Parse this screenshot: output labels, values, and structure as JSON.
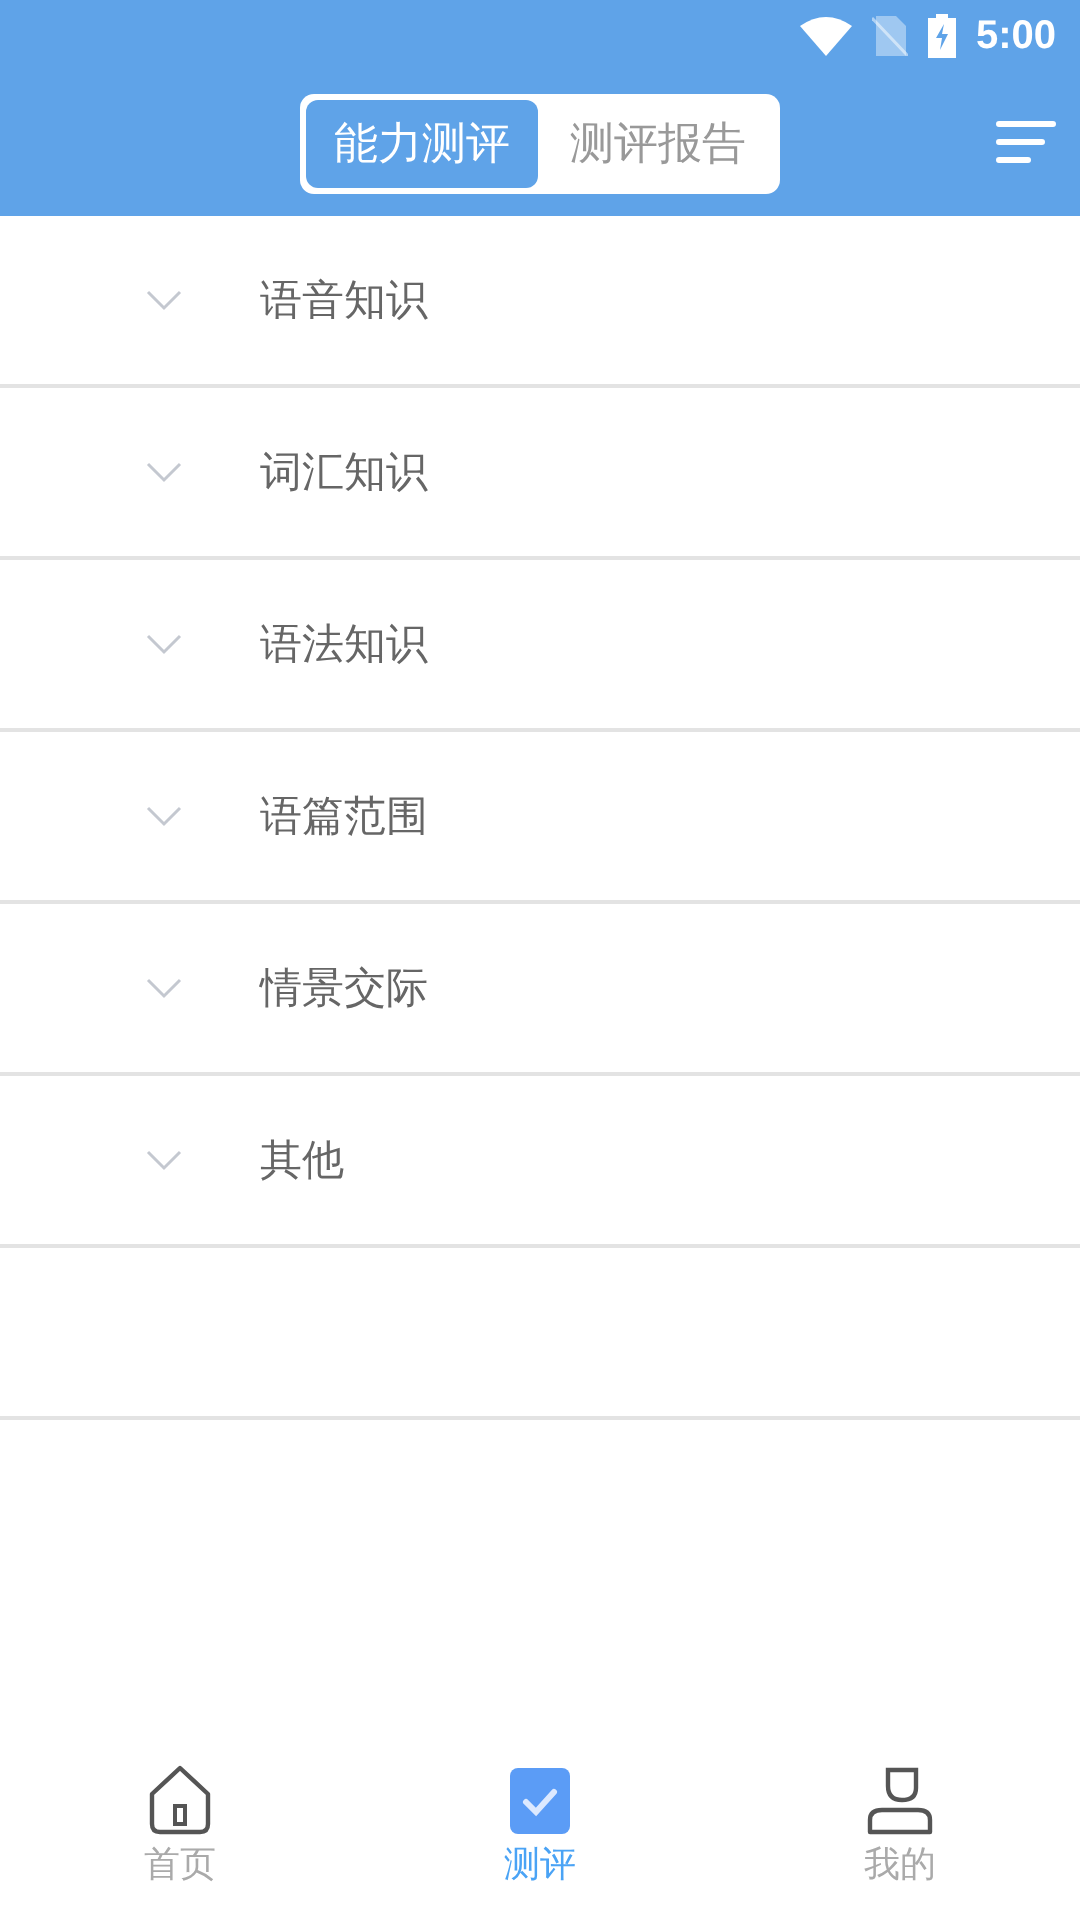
{
  "status_bar": {
    "time": "5:00"
  },
  "header": {
    "tabs": [
      {
        "label": "能力测评",
        "selected": true
      },
      {
        "label": "测评报告",
        "selected": false
      }
    ]
  },
  "categories": [
    {
      "label": "语音知识",
      "expanded": false
    },
    {
      "label": "词汇知识",
      "expanded": false
    },
    {
      "label": "语法知识",
      "expanded": false
    },
    {
      "label": "语篇范围",
      "expanded": false
    },
    {
      "label": "情景交际",
      "expanded": false
    },
    {
      "label": "其他",
      "expanded": false
    }
  ],
  "bottom_nav": [
    {
      "kind": "home",
      "label": "首页",
      "selected": false
    },
    {
      "kind": "test",
      "label": "测评",
      "selected": true
    },
    {
      "kind": "profile",
      "label": "我的",
      "selected": false
    }
  ]
}
